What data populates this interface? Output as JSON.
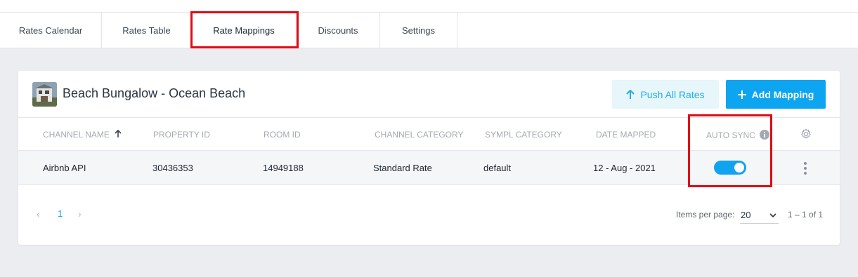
{
  "tabs": [
    {
      "label": "Rates Calendar"
    },
    {
      "label": "Rates Table"
    },
    {
      "label": "Rate Mappings",
      "active": true
    },
    {
      "label": "Discounts"
    },
    {
      "label": "Settings"
    }
  ],
  "property": {
    "title": "Beach Bungalow - Ocean Beach",
    "thumbnail_icon": "house-photo"
  },
  "actions": {
    "push_all_rates": "Push All Rates",
    "add_mapping": "Add Mapping"
  },
  "table": {
    "headers": {
      "channel_name": "CHANNEL NAME",
      "property_id": "PROPERTY ID",
      "room_id": "ROOM ID",
      "channel_category": "CHANNEL CATEGORY",
      "sympl_category": "SYMPL CATEGORY",
      "date_mapped": "DATE MAPPED",
      "auto_sync": "AUTO SYNC"
    },
    "rows": [
      {
        "channel_name": "Airbnb API",
        "property_id": "30436353",
        "room_id": "14949188",
        "channel_category": "Standard Rate",
        "sympl_category": "default",
        "date_mapped": "12 - Aug - 2021",
        "auto_sync": true
      }
    ]
  },
  "pagination": {
    "current_page": "1",
    "items_per_page_label": "Items per page:",
    "items_per_page": "20",
    "range": "1 – 1 of 1"
  },
  "colors": {
    "accent": "#0ea5f0",
    "highlight": "#e10b14"
  }
}
